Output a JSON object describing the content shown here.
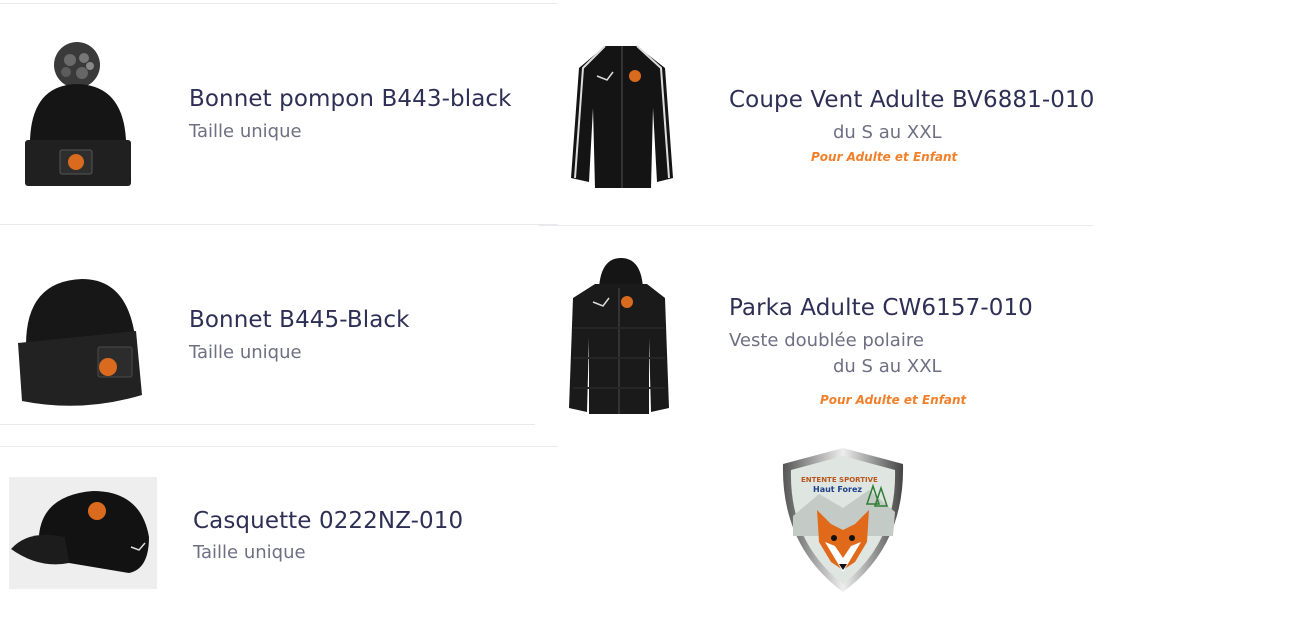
{
  "products": [
    {
      "title": "Bonnet pompon B443-black",
      "subtitle": "Taille unique",
      "icon": "pompom-beanie-icon"
    },
    {
      "title": "Coupe Vent Adulte BV6881-010",
      "subtitle": "du S au XXL",
      "note": "Pour Adulte et Enfant",
      "icon": "windbreaker-jacket-icon"
    },
    {
      "title": "Bonnet B445-Black",
      "subtitle": "Taille unique",
      "icon": "beanie-icon"
    },
    {
      "title": "Parka Adulte CW6157-010",
      "subtitle": "Veste doublée polaire",
      "subtitle2": "du S au XXL",
      "note": "Pour Adulte et Enfant",
      "icon": "hooded-parka-icon"
    },
    {
      "title": "Casquette 0222NZ-010",
      "subtitle": "Taille unique",
      "icon": "cap-icon"
    }
  ],
  "logo": {
    "line1": "ENTENTE SPORTIVE",
    "line2": "Haut Forez",
    "icon": "fox-crest-logo"
  },
  "colors": {
    "title": "#2d2f55",
    "subtitle": "#6e6f82",
    "accent": "#f2802b"
  }
}
